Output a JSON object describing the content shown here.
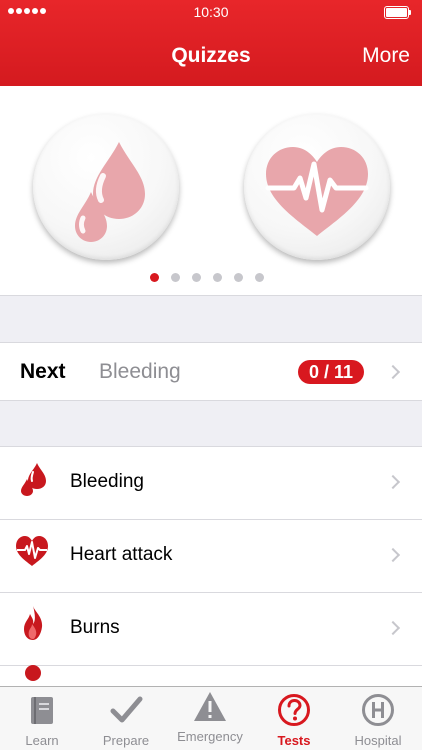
{
  "status_bar": {
    "time": "10:30"
  },
  "nav": {
    "title": "Quizzes",
    "more_label": "More"
  },
  "carousel": {
    "badges": [
      {
        "icon": "blood-drops-icon"
      },
      {
        "icon": "heart-pulse-icon"
      }
    ],
    "page_count": 6,
    "current_page": 1
  },
  "next": {
    "label": "Next",
    "topic": "Bleeding",
    "progress": "0 / 11"
  },
  "topics": [
    {
      "label": "Bleeding",
      "icon": "blood-drops-icon"
    },
    {
      "label": "Heart attack",
      "icon": "heart-pulse-icon"
    },
    {
      "label": "Burns",
      "icon": "flame-icon"
    }
  ],
  "tabs": [
    {
      "label": "Learn",
      "icon": "book-icon",
      "active": false
    },
    {
      "label": "Prepare",
      "icon": "checkmark-icon",
      "active": false
    },
    {
      "label": "Emergency",
      "icon": "warning-icon",
      "active": false
    },
    {
      "label": "Tests",
      "icon": "question-icon",
      "active": true
    },
    {
      "label": "Hospital",
      "icon": "hospital-icon",
      "active": false
    }
  ],
  "colors": {
    "accent": "#d8181f",
    "header": "#e32228",
    "badge_icon": "#e8a6ab"
  }
}
